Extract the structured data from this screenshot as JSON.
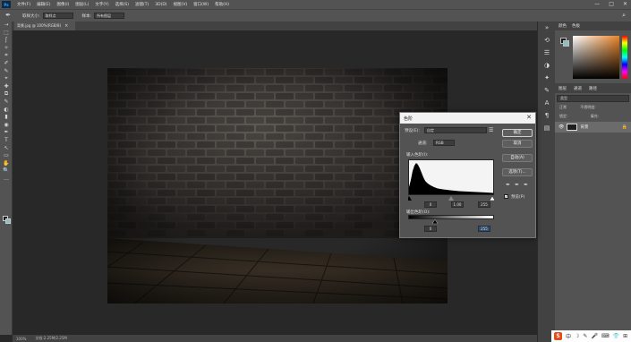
{
  "app": {
    "logo": "Ps",
    "menu": [
      "文件(F)",
      "编辑(E)",
      "图像(I)",
      "图层(L)",
      "文字(Y)",
      "选择(S)",
      "滤镜(T)",
      "3D(D)",
      "视图(V)",
      "窗口(W)",
      "帮助(H)"
    ],
    "window_controls": [
      "—",
      "□",
      "✕"
    ]
  },
  "options_bar": {
    "sample_label": "取样大小:",
    "sample_value": "取样点",
    "sample2_label": "样本:",
    "sample2_value": "所有图层"
  },
  "document": {
    "tab_title": "背景.jpg @ 100%(RGB/8)",
    "tab_close": "×"
  },
  "status_bar": {
    "zoom": "100%",
    "doc_info": "文档:2.25M/2.25M"
  },
  "right_panels": {
    "color_tabs": [
      "颜色",
      "色板"
    ],
    "layer_tabs": [
      "图层",
      "通道",
      "路径"
    ],
    "filter_label": "类型",
    "blend_mode": "正常",
    "opacity_label": "不透明度:",
    "lock_label": "锁定:",
    "fill_label": "填充:",
    "layer_name": "背景",
    "layer_lock": "🔒",
    "eye": "👁"
  },
  "tray": {
    "s_logo": "S",
    "icons": [
      "中",
      "☽",
      "✎",
      "🎤",
      "⌨",
      "👕",
      "⊞"
    ]
  },
  "levels_dialog": {
    "title": "色阶",
    "close": "✕",
    "preset_label": "预设(E):",
    "preset_value": "自定",
    "channel_label": "通道:",
    "channel_value": "RGB",
    "input_label": "输入色阶(I):",
    "input_black": "0",
    "input_gamma": "1.00",
    "input_white": "255",
    "output_label": "输出色阶(O):",
    "output_black": "0",
    "output_white": "255",
    "buttons": {
      "ok": "确定",
      "cancel": "取消",
      "auto": "自动(A)",
      "options": "选项(T)..."
    },
    "preview_label": "预览(P)",
    "preview_checked": true,
    "preset_icon": "☰"
  },
  "tools": [
    "⇢",
    "⬚",
    "ʃ",
    "✧",
    "⌗",
    "✐",
    "✎",
    "⌖",
    "✚",
    "⧉",
    "✎",
    "◐",
    "▮",
    "◉",
    "✒",
    "T",
    "↖",
    "▭",
    "✋",
    "🔍",
    "…"
  ]
}
